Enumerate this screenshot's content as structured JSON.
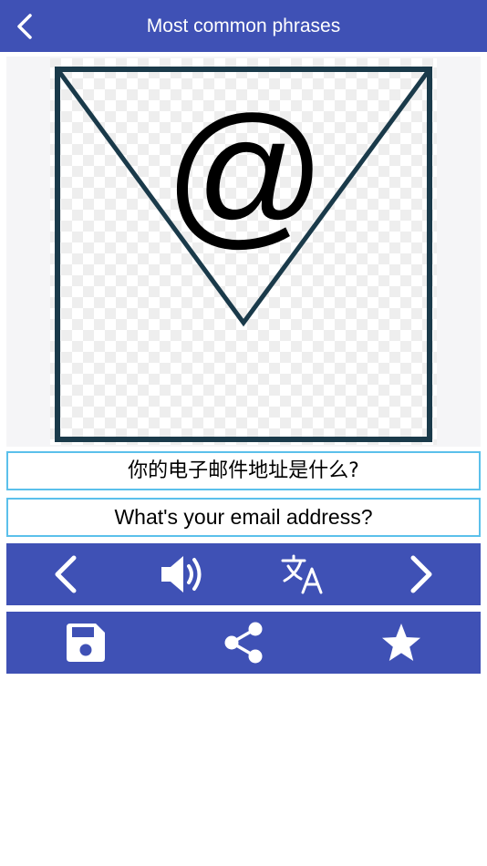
{
  "header": {
    "title": "Most common phrases",
    "back_icon": "chevron-left-icon"
  },
  "image": {
    "icon": "email-envelope-at-icon",
    "symbol": "@"
  },
  "phrase": {
    "chinese": "你的电子邮件地址是什么?",
    "english": "What's your email address?"
  },
  "toolbar_nav": {
    "icons": [
      "chevron-left-icon",
      "speaker-icon",
      "translate-icon",
      "chevron-right-icon"
    ]
  },
  "toolbar_actions": {
    "icons": [
      "save-icon",
      "share-icon",
      "star-icon"
    ]
  },
  "colors": {
    "primary": "#3f51b5",
    "border_accent": "#5bc0eb",
    "envelope_stroke": "#1a3a4a"
  }
}
